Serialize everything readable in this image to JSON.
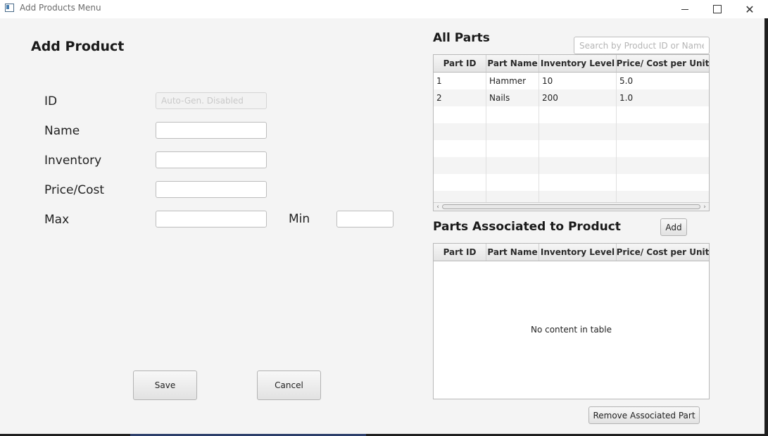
{
  "window": {
    "title": "Add Products Menu"
  },
  "form": {
    "title": "Add Product",
    "id_label": "ID",
    "id_placeholder": "Auto-Gen. Disabled",
    "name_label": "Name",
    "inventory_label": "Inventory",
    "price_label": "Price/Cost",
    "max_label": "Max",
    "min_label": "Min"
  },
  "actions": {
    "save": "Save",
    "cancel": "Cancel",
    "add": "Add",
    "remove": "Remove Associated Part"
  },
  "all_parts": {
    "title": "All Parts",
    "search_placeholder": "Search by Product ID or Name",
    "columns": [
      "Part ID",
      "Part Name",
      "Inventory Level",
      "Price/ Cost per Unit"
    ],
    "rows": [
      [
        "1",
        "Hammer",
        "10",
        "5.0"
      ],
      [
        "2",
        "Nails",
        "200",
        "1.0"
      ]
    ]
  },
  "associated_parts": {
    "title": "Parts Associated to Product",
    "columns": [
      "Part ID",
      "Part Name",
      "Inventory Level",
      "Price/ Cost per Unit"
    ],
    "empty_message": "No content in table"
  }
}
